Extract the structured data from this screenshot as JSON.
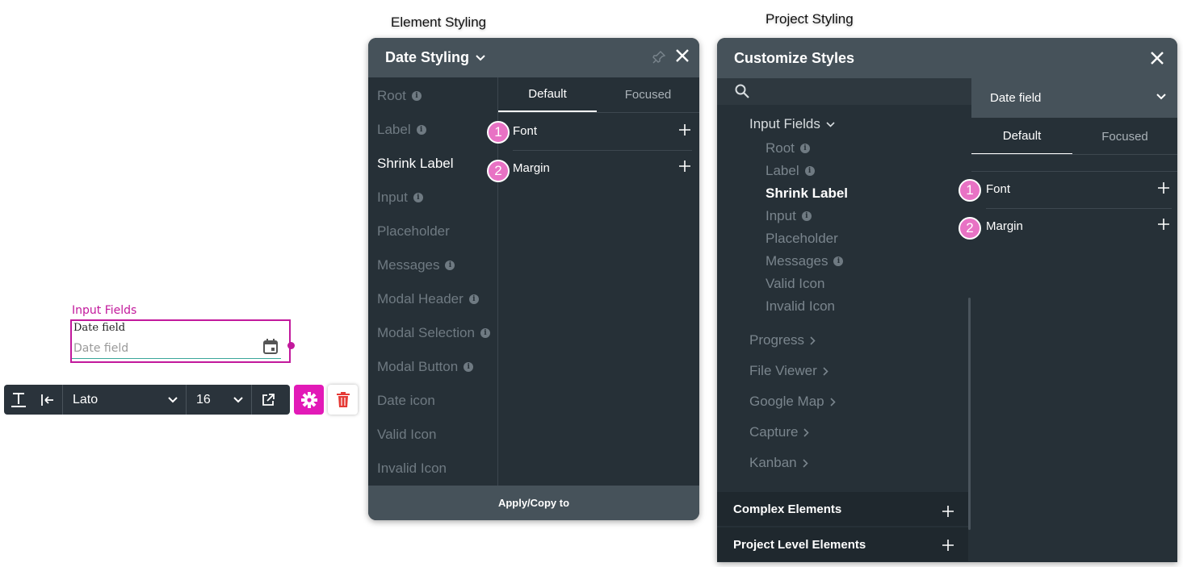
{
  "headings": {
    "element_styling": "Element Styling",
    "project_styling": "Project Styling"
  },
  "widget": {
    "caption": "Input Fields",
    "label": "Date field",
    "placeholder": "Date field",
    "icon": "calendar-icon",
    "accent_color": "#c2199c"
  },
  "toolbar": {
    "font": "Lato",
    "size": "16",
    "icons": [
      "text-format-icon",
      "align-left-icon",
      "chevron-down-icon",
      "open-external-icon",
      "gear-icon",
      "trash-icon"
    ]
  },
  "element_panel": {
    "title": "Date Styling",
    "items": [
      {
        "label": "Root",
        "info": true,
        "active": false
      },
      {
        "label": "Label",
        "info": true,
        "active": false
      },
      {
        "label": "Shrink Label",
        "info": false,
        "active": true
      },
      {
        "label": "Input",
        "info": true,
        "active": false
      },
      {
        "label": "Placeholder",
        "info": false,
        "active": false
      },
      {
        "label": "Messages",
        "info": true,
        "active": false
      },
      {
        "label": "Modal Header",
        "info": true,
        "active": false
      },
      {
        "label": "Modal Selection",
        "info": true,
        "active": false
      },
      {
        "label": "Modal Button",
        "info": true,
        "active": false
      },
      {
        "label": "Date icon",
        "info": false,
        "active": false
      },
      {
        "label": "Valid Icon",
        "info": false,
        "active": false
      },
      {
        "label": "Invalid Icon",
        "info": false,
        "active": false
      }
    ],
    "tabs": [
      "Default",
      "Focused"
    ],
    "properties": [
      {
        "badge": "1",
        "label": "Font"
      },
      {
        "badge": "2",
        "label": "Margin"
      }
    ],
    "footer": "Apply/Copy to"
  },
  "project_panel": {
    "title": "Customize Styles",
    "tree": {
      "group": "Input Fields",
      "children": [
        "Root",
        "Label",
        "Shrink Label",
        "Input",
        "Placeholder",
        "Messages",
        "Valid Icon",
        "Invalid Icon"
      ],
      "siblings": [
        "Progress",
        "File Viewer",
        "Google Map",
        "Capture",
        "Kanban"
      ]
    },
    "sections": [
      "Complex Elements",
      "Project Level Elements"
    ],
    "selected_element": "Date field",
    "tabs": [
      "Default",
      "Focused"
    ],
    "properties": [
      {
        "badge": "1",
        "label": "Font"
      },
      {
        "badge": "2",
        "label": "Margin"
      }
    ]
  },
  "info_glyph": "i",
  "colors": {
    "panel_bg": "#263037",
    "panel_header": "#46525a",
    "badge": "#e872c4",
    "gear_button": "#e21ab7",
    "trash": "#e53935"
  }
}
